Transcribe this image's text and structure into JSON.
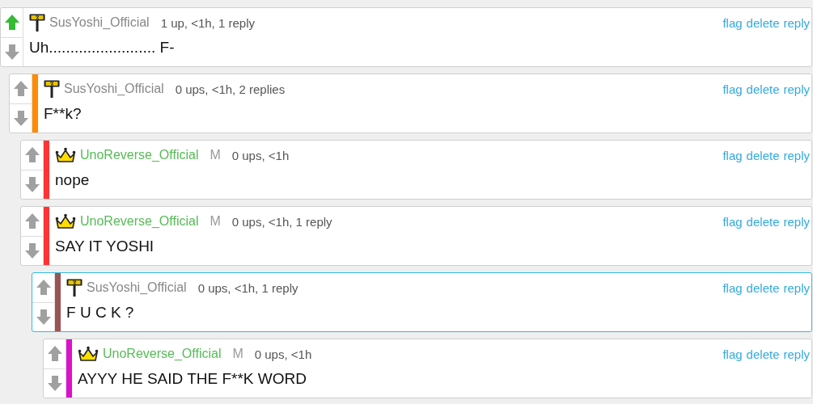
{
  "comments": [
    {
      "author": "SusYoshi_Official",
      "kind": "pole",
      "moderator": false,
      "meta": "1 up, <1h, 1 reply",
      "upvoted": true,
      "downvoted": false,
      "highlighted": false,
      "body": "Uh......................... F-",
      "actions": [
        "flag",
        "delete",
        "reply"
      ],
      "children": [
        {
          "author": "SusYoshi_Official",
          "kind": "pole",
          "moderator": false,
          "meta": "0 ups, <1h, 2 replies",
          "upvoted": false,
          "downvoted": false,
          "highlighted": false,
          "color": "#ff8c00",
          "body": "F**k?",
          "actions": [
            "flag",
            "delete",
            "reply"
          ],
          "children": [
            {
              "author": "UnoReverse_Official",
              "kind": "crown",
              "moderator": true,
              "badge": "M",
              "meta": "0 ups, <1h",
              "upvoted": false,
              "downvoted": false,
              "highlighted": false,
              "color": "#ff3333",
              "body": "nope",
              "actions": [
                "flag",
                "delete",
                "reply"
              ]
            },
            {
              "author": "UnoReverse_Official",
              "kind": "crown",
              "moderator": true,
              "badge": "M",
              "meta": "0 ups, <1h, 1 reply",
              "upvoted": false,
              "downvoted": false,
              "highlighted": false,
              "color": "#ff3333",
              "body": "SAY IT YOSHI",
              "actions": [
                "flag",
                "delete",
                "reply"
              ],
              "children": [
                {
                  "author": "SusYoshi_Official",
                  "kind": "pole",
                  "moderator": false,
                  "meta": "0 ups, <1h, 1 reply",
                  "upvoted": false,
                  "downvoted": false,
                  "highlighted": true,
                  "color": "#995555",
                  "body": "F U C K ?",
                  "actions": [
                    "flag",
                    "delete",
                    "reply"
                  ],
                  "children": [
                    {
                      "author": "UnoReverse_Official",
                      "kind": "crown",
                      "moderator": true,
                      "badge": "M",
                      "meta": "0 ups, <1h",
                      "upvoted": false,
                      "downvoted": false,
                      "highlighted": false,
                      "color": "#dd11cc",
                      "body": "AYYY HE SAID THE F**K WORD",
                      "actions": [
                        "flag",
                        "delete",
                        "reply"
                      ]
                    }
                  ]
                }
              ]
            }
          ]
        }
      ]
    }
  ]
}
